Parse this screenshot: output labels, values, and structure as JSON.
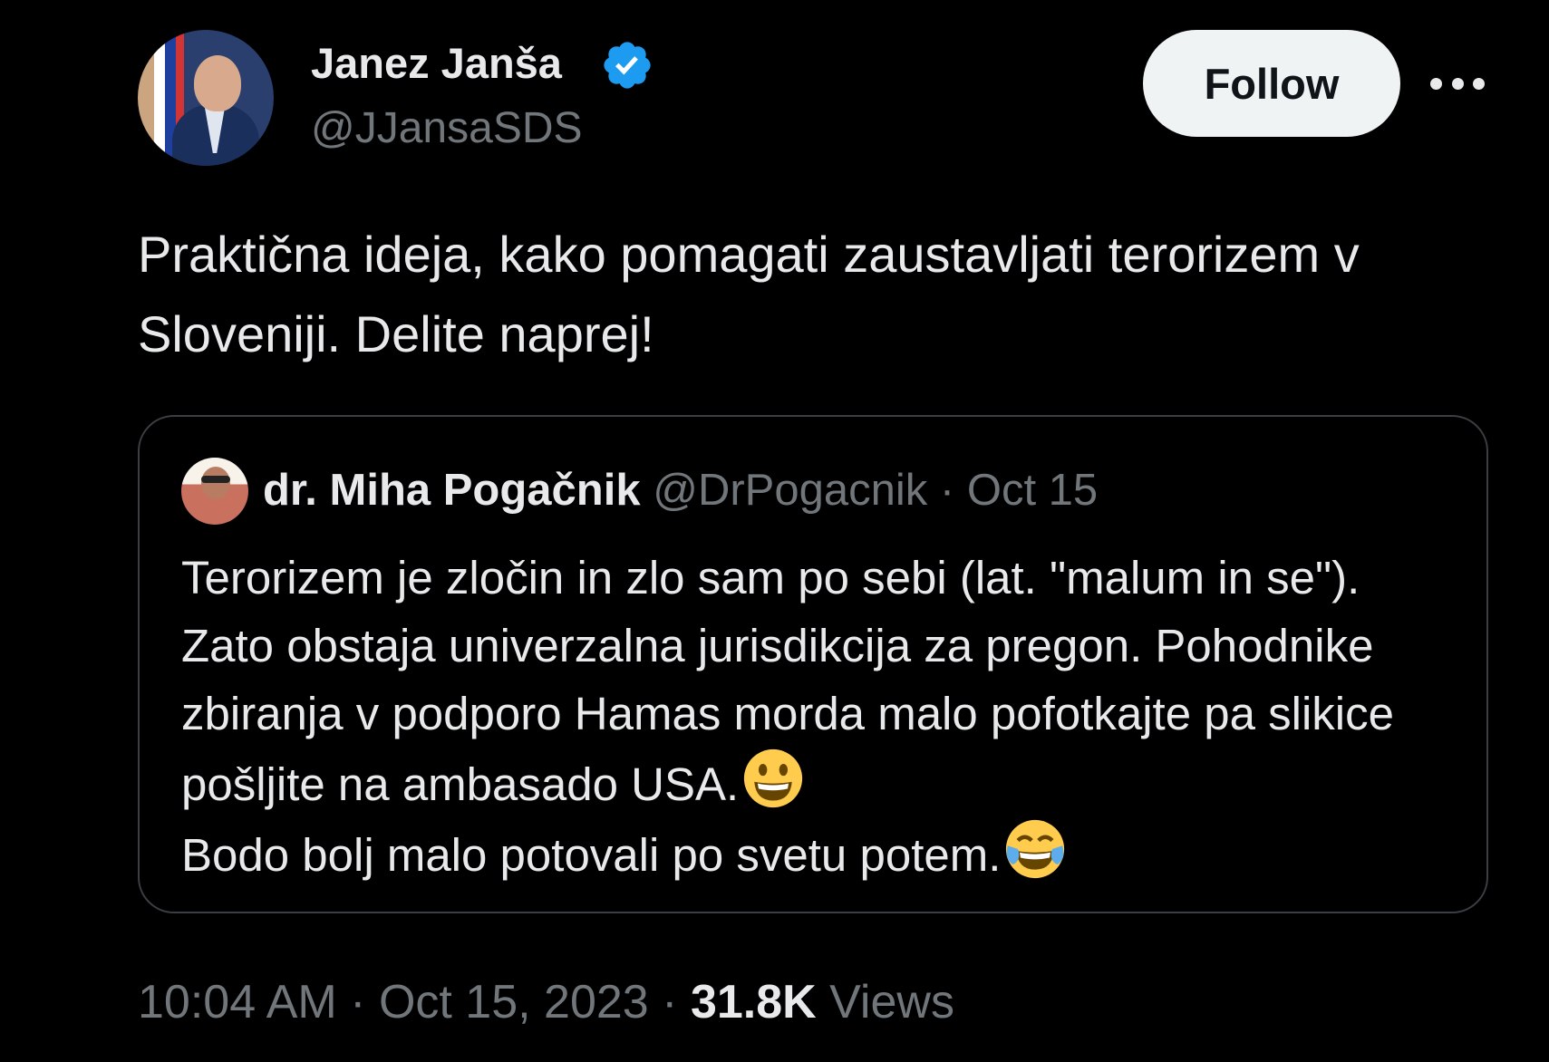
{
  "author": {
    "name": "Janez Janša",
    "handle": "@JJansaSDS",
    "verified_icon": "verified-badge-icon"
  },
  "actions": {
    "follow_label": "Follow",
    "more_icon": "more-horizontal-icon"
  },
  "tweet": {
    "text": "Praktična ideja, kako pomagati zaustavljati terorizem v Sloveniji. Delite naprej!"
  },
  "quote": {
    "name": "dr. Miha Pogačnik",
    "handle": "@DrPogacnik",
    "date": "Oct 15",
    "text_main": "Terorizem je zločin in zlo sam po sebi (lat. \"malum in se\"). Zato obstaja univerzalna jurisdikcija za pregon. Pohodnike zbiranja v podporo Hamas morda malo pofotkajte pa slikice pošljite na ambasado USA.",
    "text_tail": "Bodo bolj malo potovali po svetu potem.",
    "emoji_1": "grinning-face-emoji",
    "emoji_2": "face-with-tears-of-joy-emoji"
  },
  "footer": {
    "time": "10:04 AM",
    "date": "Oct 15, 2023",
    "views_count": "31.8K",
    "views_label": "Views"
  },
  "colors": {
    "background": "#000000",
    "text_primary": "#e7e9ea",
    "text_secondary": "#71767b",
    "verified_blue": "#1d9bf0",
    "follow_bg": "#eff3f4",
    "border": "#3b3f43"
  }
}
